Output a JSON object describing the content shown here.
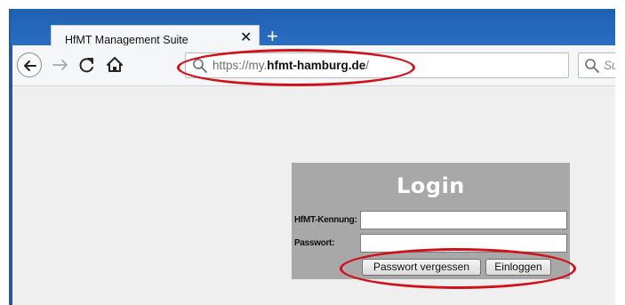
{
  "browser": {
    "tab": {
      "title": "HfMT Management Suite",
      "close_glyph": "✕"
    },
    "new_tab_glyph": "+",
    "nav": {
      "back_icon": "back-arrow-icon",
      "forward_icon": "forward-arrow-icon",
      "reload_icon": "reload-icon",
      "home_icon": "home-icon"
    },
    "url": {
      "prefix": "https://my.",
      "host": "hfmt-hamburg.de",
      "suffix": "/"
    },
    "search": {
      "placeholder": "Su"
    }
  },
  "login": {
    "title": "Login",
    "username_label": "HfMT-Kennung:",
    "password_label": "Passwort:",
    "username_value": "",
    "password_value": "",
    "forgot_button": "Passwort vergessen",
    "login_button": "Einloggen"
  },
  "annotations": {
    "color": "#d0101a"
  },
  "colors": {
    "tabstrip": "#2a6fc2",
    "login_box": "#a8a8a8",
    "page_background": "#efefef"
  }
}
